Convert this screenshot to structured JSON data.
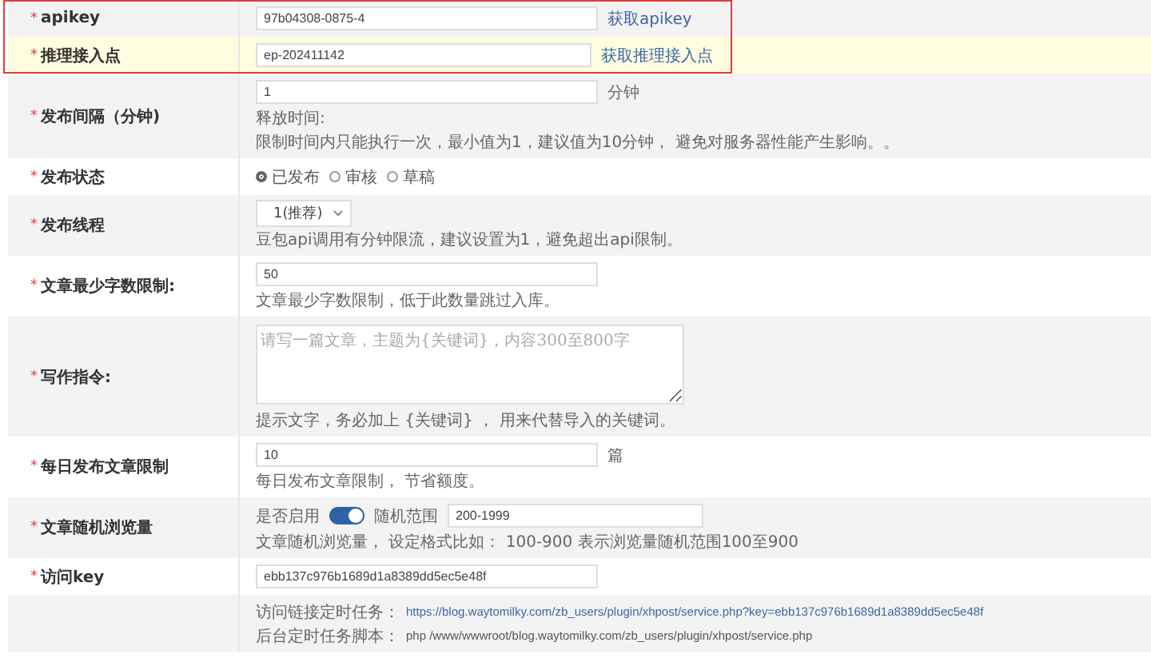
{
  "rows": [
    {
      "kind": "input",
      "mark": "*",
      "label": "apikey",
      "highlighted": false,
      "value": "97b04308-0875-4",
      "link": "获取apikey"
    },
    {
      "kind": "input",
      "mark": "*",
      "label": "推理接入点",
      "highlighted": true,
      "value": "ep-202411142",
      "link": "获取推理接入点"
    },
    {
      "kind": "input",
      "mark": "*",
      "label": "发布间隔（分钟)",
      "highlighted": false,
      "value": "1",
      "unit": "分钟",
      "hints": [
        "释放时间:",
        "限制时间内只能执行一次，最小值为1，建议值为10分钟， 避免对服务器性能产生影响。。"
      ]
    },
    {
      "kind": "radio",
      "mark": "*",
      "label": "发布状态",
      "highlighted": false,
      "options": [
        {
          "label": "已发布",
          "selected": true
        },
        {
          "label": "审核",
          "selected": false
        },
        {
          "label": "草稿",
          "selected": false
        }
      ]
    },
    {
      "kind": "select",
      "mark": "*",
      "label": "发布线程",
      "highlighted": false,
      "value": "1(推荐)",
      "hints": [
        "豆包api调用有分钟限流，建议设置为1，避免超出api限制。"
      ]
    },
    {
      "kind": "input",
      "mark": "*",
      "label": "文章最少字数限制:",
      "highlighted": false,
      "value": "50",
      "hints": [
        "文章最少字数限制，低于此数量跳过入库。"
      ]
    },
    {
      "kind": "textarea",
      "mark": "*",
      "label": "写作指令:",
      "highlighted": false,
      "placeholder": "请写一篇文章，主题为{关键词}，内容300至800字",
      "hints": [
        "提示文字，务必加上 {关键词} ， 用来代替导入的关键词。"
      ]
    },
    {
      "kind": "input",
      "mark": "*",
      "label": "每日发布文章限制",
      "highlighted": false,
      "value": "10",
      "unit": "篇",
      "hints": [
        "每日发布文章限制， 节省额度。"
      ]
    },
    {
      "kind": "toggle",
      "mark": "*",
      "label": "文章随机浏览量",
      "highlighted": false,
      "toggle_label": "是否启用",
      "on": true,
      "range_label": "随机范围",
      "value": "200-1999",
      "hints": [
        "文章随机浏览量， 设定格式比如： 100-900 表示浏览量随机范围100至900"
      ]
    },
    {
      "kind": "input",
      "mark": "*",
      "label": "访问key",
      "highlighted": false,
      "value": "ebb137c976b1689d1a8389dd5ec5e48f"
    },
    {
      "kind": "info",
      "highlighted": false,
      "lines": [
        {
          "label": "访问链接定时任务：",
          "text": "https://blog.waytomilky.com/zb_users/plugin/xhpost/service.php?key=ebb137c976b1689d1a8389dd5ec5e48f",
          "link": true
        },
        {
          "label": "后台定时任务脚本：",
          "text": "php /www/wwwroot/blog.waytomilky.com/zb_users/plugin/xhpost/service.php",
          "link": false
        }
      ]
    }
  ]
}
